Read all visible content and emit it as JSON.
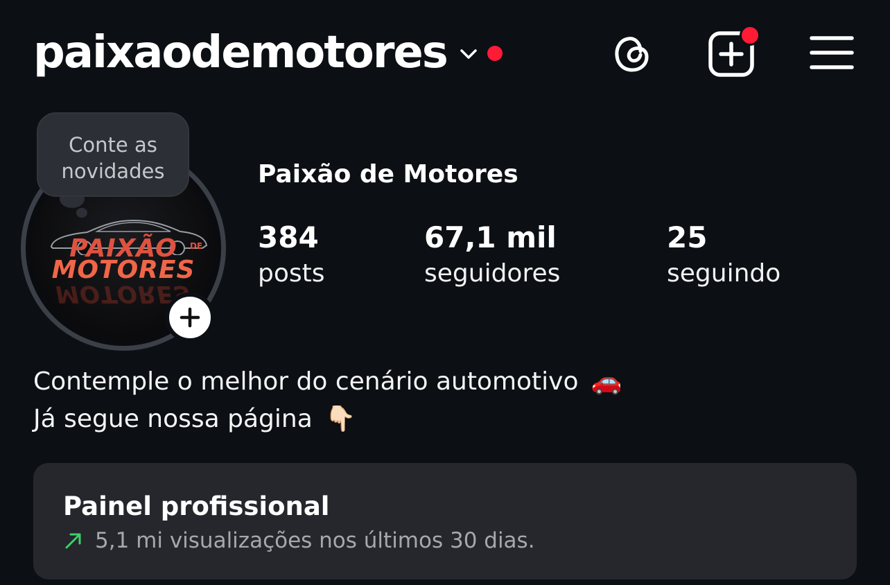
{
  "header": {
    "username": "paixaodemotores",
    "icons": [
      "chevron-down-icon",
      "threads-icon",
      "create-icon",
      "menu-icon"
    ],
    "notification_dot_color": "#ff1a36"
  },
  "avatar": {
    "logo_line1": "PAIXÃO",
    "logo_de": "DE",
    "logo_line2": "MOTORES",
    "logo_color": "#e0523f"
  },
  "note": {
    "text_line1": "Conte as",
    "text_line2": "novidades"
  },
  "profile": {
    "display_name": "Paixão de Motores",
    "stats": {
      "posts": {
        "value": "384",
        "label": "posts"
      },
      "followers": {
        "value": "67,1 mil",
        "label": "seguidores"
      },
      "following": {
        "value": "25",
        "label": "seguindo"
      }
    },
    "bio": {
      "line1": "Contemple o melhor do cenário automotivo",
      "line1_emoji": "🚗",
      "line2": "Já segue nossa página",
      "line2_emoji": "👇🏻"
    }
  },
  "dashboard": {
    "title": "Painel profissional",
    "subtitle": "5,1 mi visualizações nos últimos 30 dias.",
    "trend_color": "#3ecf6c"
  }
}
